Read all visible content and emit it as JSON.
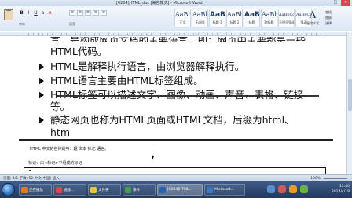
{
  "window": {
    "title": "[0204]HTML_doc [兼容模式] - Microsoft Word",
    "minimize": "–",
    "maximize": "□",
    "close": "×"
  },
  "ribbon": {
    "font_label": "字体",
    "para_label": "段落",
    "styles": [
      {
        "sample": "AaBbCcDc",
        "name": "正文"
      },
      {
        "sample": "AaBbCcDc",
        "name": "无间隔"
      },
      {
        "sample": "AaBl",
        "name": "标题 1"
      },
      {
        "sample": "AaBbC",
        "name": "标题 2"
      },
      {
        "sample": "AaBbC",
        "name": "标题"
      },
      {
        "sample": "AaBbC",
        "name": "副标题"
      },
      {
        "sample": "AaBbCcD",
        "name": "不明显强调"
      },
      {
        "sample": "AaBbCcDc",
        "name": "强调"
      }
    ],
    "change_styles_glyph": "A",
    "change_styles_label": "更改样式",
    "editing": [
      "查找",
      "替换",
      "选择"
    ]
  },
  "slide": {
    "cut_line": "言，是构成网页文档的主要语言。即：网页中主要都是一些",
    "line0_cont": "HTML代码。",
    "bullet1": "HTML是解释执行语言，由浏览器解释执行。",
    "bullet2": "HTML语言主要由HTML标签组成。",
    "bullet3": "HTML标签可以描述文字、图像、动画、声音、表格、链接",
    "bullet3_cont": "等。",
    "bullet4": "静态网页也称为HTML页面或HTML文档，后缀为html、",
    "bullet4_cont": "htm"
  },
  "doc": {
    "line1": "HTML 中文的名称是叫：超  文本  标记  语言。",
    "line2": "标记：由<标记>中组成的标记"
  },
  "status": {
    "left": "页面: 1/1   字数: 52   中文(中国)   插入",
    "zoom": "100%"
  },
  "taskbar": {
    "items": [
      {
        "label": "正在播放",
        "color": "#e07a22"
      },
      {
        "label": "视频...",
        "color": "#d94a4a"
      },
      {
        "label": "文件夹",
        "color": "#e6c34a"
      },
      {
        "label": "课件",
        "color": "#4aa04a"
      },
      {
        "label": "[0204]HTML...",
        "color": "#2b5fb0"
      },
      {
        "label": "Microsoft...",
        "color": "#3a78c8"
      }
    ],
    "clock_time": "12:40",
    "clock_date": "2014/4/18"
  }
}
